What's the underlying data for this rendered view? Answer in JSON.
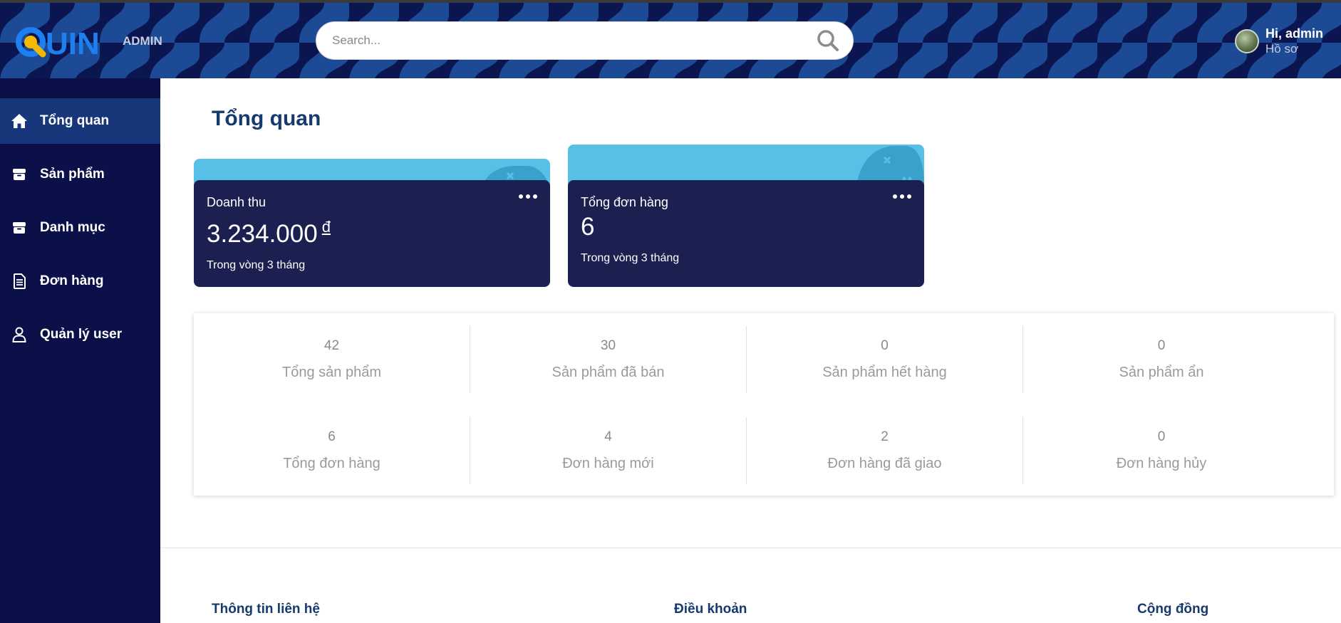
{
  "header": {
    "logo_text": "QUIN",
    "admin_label": "ADMIN",
    "search_placeholder": "Search...",
    "greeting": "Hi, admin",
    "profile_link": "Hồ sơ"
  },
  "sidebar": {
    "items": [
      {
        "label": "Tổng quan",
        "icon": "home-icon",
        "active": true
      },
      {
        "label": "Sản phẩm",
        "icon": "box-icon",
        "active": false
      },
      {
        "label": "Danh mục",
        "icon": "box-icon",
        "active": false
      },
      {
        "label": "Đơn hàng",
        "icon": "document-icon",
        "active": false
      },
      {
        "label": "Quản lý user",
        "icon": "user-icon",
        "active": false
      }
    ]
  },
  "main": {
    "title": "Tổng quan",
    "cards": [
      {
        "label": "Doanh thu",
        "value": "3.234.000",
        "currency": "đ",
        "sub": "Trong vòng 3 tháng"
      },
      {
        "label": "Tổng đơn hàng",
        "value": "6",
        "currency": "",
        "sub": "Trong vòng 3 tháng"
      }
    ],
    "stats": [
      [
        {
          "value": "42",
          "label": "Tổng sản phẩm"
        },
        {
          "value": "30",
          "label": "Sản phẩm đã bán"
        },
        {
          "value": "0",
          "label": "Sản phẩm hết hàng"
        },
        {
          "value": "0",
          "label": "Sản phẩm ẩn"
        }
      ],
      [
        {
          "value": "6",
          "label": "Tổng đơn hàng"
        },
        {
          "value": "4",
          "label": "Đơn hàng mới"
        },
        {
          "value": "2",
          "label": "Đơn hàng đã giao"
        },
        {
          "value": "0",
          "label": "Đơn hàng hủy"
        }
      ]
    ]
  },
  "footer": {
    "contact": "Thông tin liên hệ",
    "terms": "Điều khoản",
    "community": "Cộng đồng"
  },
  "colors": {
    "header_bg": "#0b1550",
    "sidebar_bg": "#0b1048",
    "sidebar_active": "#17377a",
    "card_bg": "#1b2050",
    "card_accent": "#57c0e6",
    "title": "#173a6e",
    "logo_blue": "#1e7ff0",
    "logo_yellow": "#f5b800"
  }
}
